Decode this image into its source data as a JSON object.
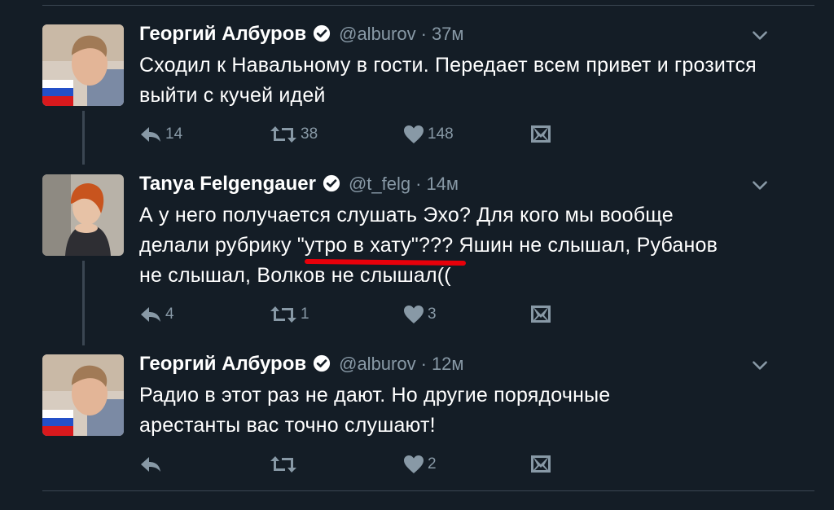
{
  "colors": {
    "background": "#141d26",
    "text": "#ffffff",
    "muted": "#8899a6",
    "verified": "#ffffff",
    "annotation": "#e8000a"
  },
  "tweets": [
    {
      "author": "Георгий Албуров",
      "handle": "@alburov",
      "separator": "·",
      "time": "37м",
      "text": "Сходил к Навальному в гости. Передает всем привет и грозится выйти с кучей идей",
      "replies": "14",
      "retweets": "38",
      "likes": "148",
      "icons": [
        "reply-icon",
        "retweet-icon",
        "like-icon",
        "message-icon",
        "chevron-down-icon",
        "verified-icon"
      ]
    },
    {
      "author": "Tanya Felgengauer",
      "handle": "@t_felg",
      "separator": "·",
      "time": "14м",
      "text": "А у него получается слушать Эхо? Для кого мы вообще делали рубрику \"утро в хату\"??? Яшин не слышал, Рубанов не слышал, Волков не слышал((",
      "replies": "4",
      "retweets": "1",
      "likes": "3",
      "icons": [
        "reply-icon",
        "retweet-icon",
        "like-icon",
        "message-icon",
        "chevron-down-icon",
        "verified-icon"
      ]
    },
    {
      "author": "Георгий Албуров",
      "handle": "@alburov",
      "separator": "·",
      "time": "12м",
      "text": "Радио в этот раз не дают. Но другие порядочные арестанты вас точно слушают!",
      "replies": "",
      "retweets": "",
      "likes": "2",
      "icons": [
        "reply-icon",
        "retweet-icon",
        "like-icon",
        "message-icon",
        "chevron-down-icon",
        "verified-icon"
      ]
    }
  ]
}
